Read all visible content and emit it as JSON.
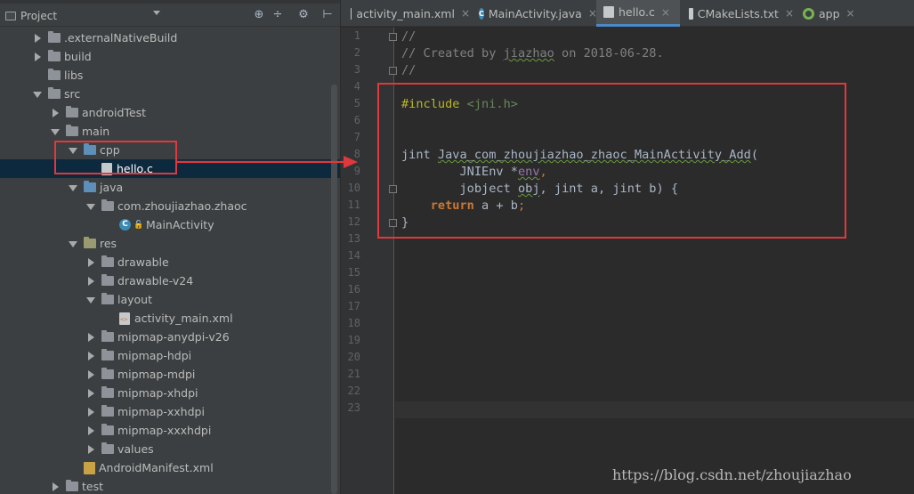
{
  "project_panel": {
    "title": "Project",
    "buttons": [
      "globe-icon",
      "split-icon",
      "gear-icon",
      "hide-icon"
    ],
    "tree": [
      {
        "label": ".externalNativeBuild",
        "icon": "folder",
        "indent": 0,
        "expand": "right"
      },
      {
        "label": "build",
        "icon": "folder",
        "indent": 0,
        "expand": "right"
      },
      {
        "label": "libs",
        "icon": "folder",
        "indent": 0,
        "expand": "none"
      },
      {
        "label": "src",
        "icon": "folder",
        "indent": 0,
        "expand": "down"
      },
      {
        "label": "androidTest",
        "icon": "folder",
        "indent": 1,
        "expand": "right"
      },
      {
        "label": "main",
        "icon": "folder",
        "indent": 1,
        "expand": "down"
      },
      {
        "label": "cpp",
        "icon": "folder-blue",
        "indent": 2,
        "expand": "down"
      },
      {
        "label": "hello.c",
        "icon": "file",
        "indent": 3,
        "expand": "none",
        "selected": true
      },
      {
        "label": "java",
        "icon": "folder-blue",
        "indent": 2,
        "expand": "down"
      },
      {
        "label": "com.zhoujiazhao.zhaoc",
        "icon": "folder",
        "indent": 3,
        "expand": "down"
      },
      {
        "label": "MainActivity",
        "icon": "class",
        "indent": 4,
        "expand": "none"
      },
      {
        "label": "res",
        "icon": "folder-res",
        "indent": 2,
        "expand": "down"
      },
      {
        "label": "drawable",
        "icon": "folder",
        "indent": 3,
        "expand": "right"
      },
      {
        "label": "drawable-v24",
        "icon": "folder",
        "indent": 3,
        "expand": "right"
      },
      {
        "label": "layout",
        "icon": "folder",
        "indent": 3,
        "expand": "down"
      },
      {
        "label": "activity_main.xml",
        "icon": "xml",
        "indent": 4,
        "expand": "none"
      },
      {
        "label": "mipmap-anydpi-v26",
        "icon": "folder",
        "indent": 3,
        "expand": "right"
      },
      {
        "label": "mipmap-hdpi",
        "icon": "folder",
        "indent": 3,
        "expand": "right"
      },
      {
        "label": "mipmap-mdpi",
        "icon": "folder",
        "indent": 3,
        "expand": "right"
      },
      {
        "label": "mipmap-xhdpi",
        "icon": "folder",
        "indent": 3,
        "expand": "right"
      },
      {
        "label": "mipmap-xxhdpi",
        "icon": "folder",
        "indent": 3,
        "expand": "right"
      },
      {
        "label": "mipmap-xxxhdpi",
        "icon": "folder",
        "indent": 3,
        "expand": "right"
      },
      {
        "label": "values",
        "icon": "folder",
        "indent": 3,
        "expand": "right"
      },
      {
        "label": "AndroidManifest.xml",
        "icon": "manifest",
        "indent": 2,
        "expand": "none"
      },
      {
        "label": "test",
        "icon": "folder",
        "indent": 1,
        "expand": "right"
      }
    ]
  },
  "tabs": [
    {
      "label": "activity_main.xml",
      "icon": "xml-file-icon",
      "active": false,
      "close": "×"
    },
    {
      "label": "MainActivity.java",
      "icon": "java-class-icon",
      "active": false,
      "close": "×"
    },
    {
      "label": "hello.c",
      "icon": "c-file-icon",
      "active": true,
      "close": "×"
    },
    {
      "label": "CMakeLists.txt",
      "icon": "cmake-file-icon",
      "active": false,
      "close": "×"
    },
    {
      "label": "app",
      "icon": "gradle-app-icon",
      "active": false,
      "close": "×"
    }
  ],
  "editor": {
    "line_numbers": [
      "1",
      "2",
      "3",
      "4",
      "5",
      "6",
      "7",
      "8",
      "9",
      "10",
      "11",
      "12",
      "13",
      "14",
      "15",
      "16",
      "17",
      "18",
      "19",
      "20",
      "21",
      "22",
      "23"
    ],
    "code": [
      [
        {
          "t": "//",
          "c": "comment"
        }
      ],
      [
        {
          "t": "// Created by ",
          "c": "comment"
        },
        {
          "t": "jiazhao",
          "c": "comment squig"
        },
        {
          "t": " on 2018-06-28.",
          "c": "comment"
        }
      ],
      [
        {
          "t": "//",
          "c": "comment"
        }
      ],
      [],
      [
        {
          "t": "#include ",
          "c": "macro"
        },
        {
          "t": "<jni.h>",
          "c": "header"
        }
      ],
      [],
      [],
      [
        {
          "t": "jint ",
          "c": ""
        },
        {
          "t": "Java_com_zhoujiazhao_zhaoc_MainActivity_Add",
          "c": "squig"
        },
        {
          "t": "(",
          "c": ""
        }
      ],
      [
        {
          "t": "        JNIEnv *",
          "c": ""
        },
        {
          "t": "env",
          "c": "param squig"
        },
        {
          "t": ",",
          "c": "kwplain"
        }
      ],
      [
        {
          "t": "        jobject ",
          "c": ""
        },
        {
          "t": "obj",
          "c": "squig"
        },
        {
          "t": ", jint a, jint b) {",
          "c": ""
        }
      ],
      [
        {
          "t": "    ",
          "c": ""
        },
        {
          "t": "return",
          "c": "kw"
        },
        {
          "t": " a + b",
          "c": ""
        },
        {
          "t": ";",
          "c": "kwplain"
        }
      ],
      [
        {
          "t": "}",
          "c": ""
        }
      ],
      [],
      [],
      [],
      [],
      [],
      [],
      [],
      [],
      [],
      [],
      []
    ]
  },
  "watermark": "https://blog.csdn.net/zhoujiazhao",
  "colors": {
    "annotation_red": "#e0383c",
    "selection": "#0d293e",
    "active_tab_underline": "#4a88c7"
  }
}
